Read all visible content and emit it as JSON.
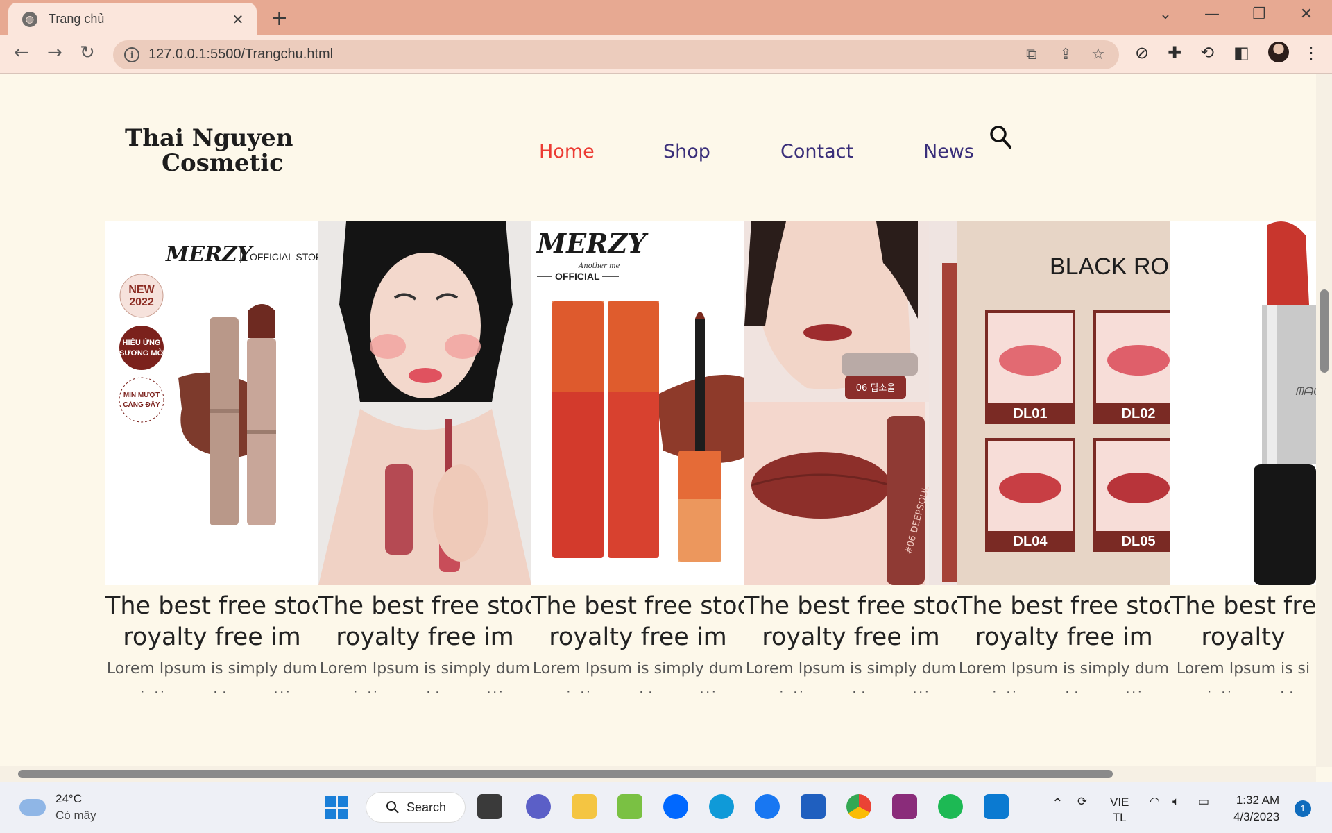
{
  "browser": {
    "tab_title": "Trang chủ",
    "tab_close": "✕",
    "new_tab": "+",
    "url": "127.0.0.1:5500/Trangchu.html",
    "accent": "#e7a992"
  },
  "site": {
    "logo_line1": "Thai Nguyen",
    "logo_line2": "Cosmetic",
    "nav": [
      {
        "label": "Home",
        "active": true
      },
      {
        "label": "Shop",
        "active": false
      },
      {
        "label": "Contact",
        "active": false
      },
      {
        "label": "News",
        "active": false
      }
    ],
    "nav_active_color": "#ec3b33",
    "nav_color": "#3a2f7a"
  },
  "products": [
    {
      "title1": "The best free stoc",
      "title2": "royalty free im",
      "desc1": "Lorem Ipsum is simply dum",
      "desc2": "printing and typesettin",
      "image": "merzy-lipstick-official-store",
      "img_text": [
        "MERZY",
        "OFFICIAL STOR",
        "NEW",
        "2022",
        "HIỆU ỨNG",
        "SƯƠNG MỜ",
        "MỊN MƯỢT",
        "CĂNG ĐẦY"
      ],
      "rating": 0
    },
    {
      "title1": "The best free stoc",
      "title2": "royalty free im",
      "desc1": "Lorem Ipsum is simply dum",
      "desc2": "printing and typesettin",
      "image": "model-holding-lip-tint",
      "img_text": [],
      "rating": 0
    },
    {
      "title1": "The best free stoc",
      "title2": "royalty free im",
      "desc1": "Lorem Ipsum is simply dum",
      "desc2": "printing and typesettin",
      "image": "merzy-red-lip-tint",
      "img_text": [
        "MERZY",
        "Another me",
        "OFFICIAL"
      ],
      "rating": 0
    },
    {
      "title1": "The best free stoc",
      "title2": "royalty free im",
      "desc1": "Lorem Ipsum is simply dum",
      "desc2": "printing and typesettin",
      "image": "lip-tint-swatch-deepsoul",
      "img_text": [
        "06 딥소울",
        "#06 DEEPSOUL"
      ],
      "rating": 0
    },
    {
      "title1": "The best free stoc",
      "title2": "royalty free im",
      "desc1": "Lorem Ipsum is simply dum",
      "desc2": "printing and typesettin",
      "image": "black-rouge-lip-shades",
      "img_text": [
        "BLACK RO",
        "DL01",
        "DL02",
        "DL04",
        "DL05"
      ],
      "rating": 0
    },
    {
      "title1": "The best free",
      "title2": "royalty",
      "desc1": "Lorem Ipsum is si",
      "desc2": "printing and t",
      "image": "mac-red-lipstick",
      "img_text": [],
      "rating": 0
    }
  ],
  "taskbar": {
    "weather_temp": "24°C",
    "weather_cond": "Có mây",
    "search_label": "Search",
    "lang1": "VIE",
    "lang2": "TL",
    "time": "1:32 AM",
    "date": "4/3/2023",
    "notifications": "1"
  }
}
